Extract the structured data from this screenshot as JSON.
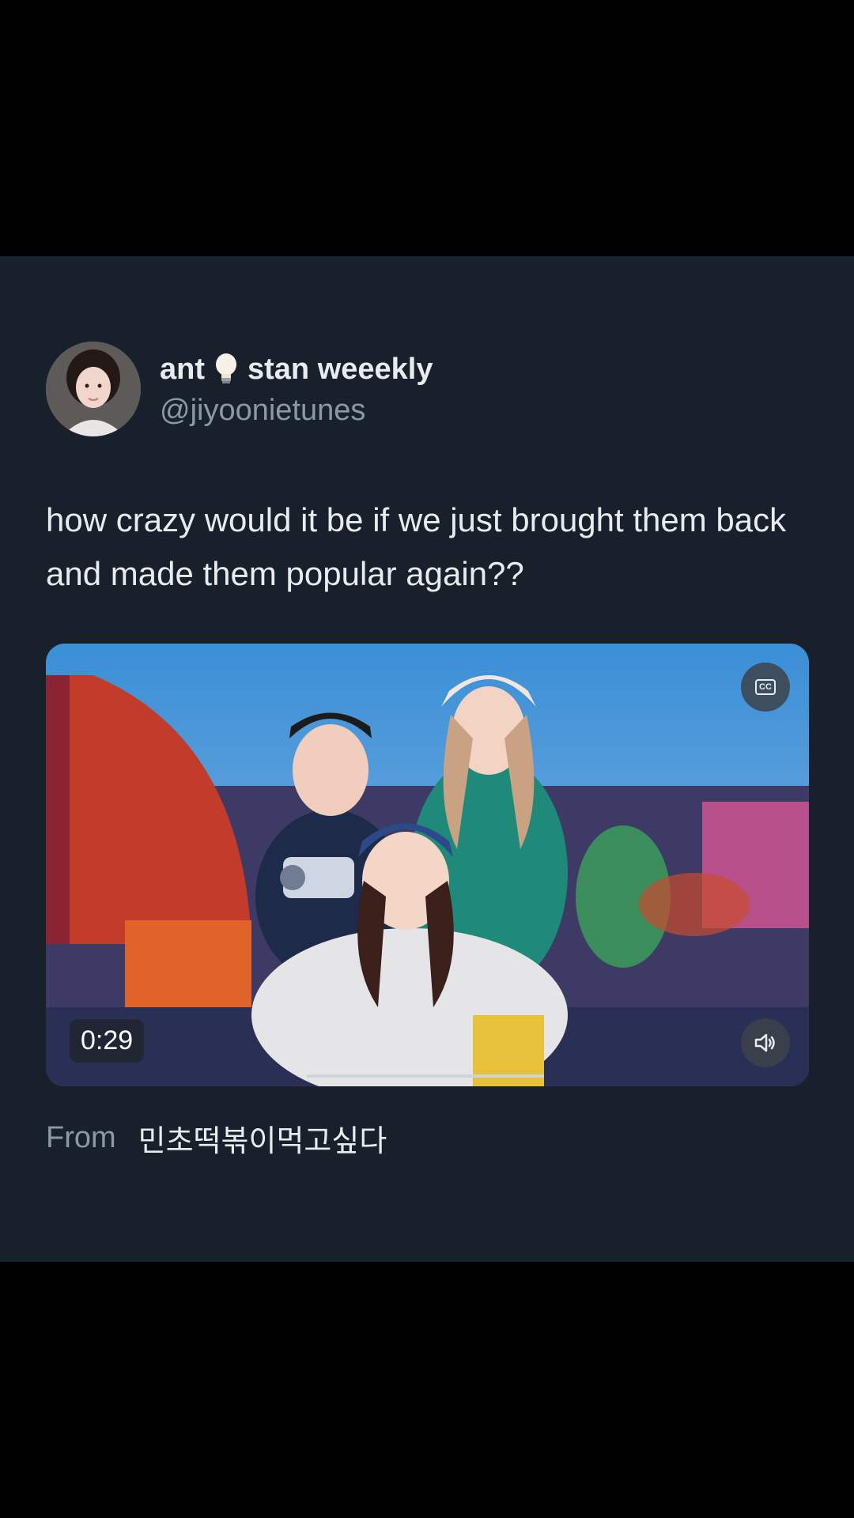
{
  "tweet": {
    "display_name_part1": "ant",
    "display_name_part2": "stan weeekly",
    "emoji_icon": "lightbulb-icon",
    "handle": "@jiyoonietunes",
    "text": "how crazy would it be if we just brought them back and made them popular again??"
  },
  "media": {
    "duration": "0:29",
    "cc_icon": "closed-captions-icon",
    "volume_icon": "speaker-icon",
    "cc_label": "CC"
  },
  "attribution": {
    "from_label": "From",
    "from_name": "민초떡볶이먹고싶다"
  },
  "colors": {
    "background": "#000000",
    "card": "#18212b",
    "primary_text": "#e8ecef",
    "secondary_text": "#8b98a5"
  }
}
